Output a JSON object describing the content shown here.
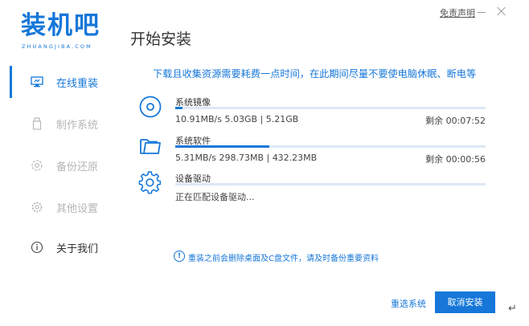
{
  "app": {
    "logo_text": "装机吧",
    "logo_sub": "ZHUANGJIBA.COM",
    "brand_color": "#1677d9",
    "disclaimer": "免责声明"
  },
  "page": {
    "title": "开始安装"
  },
  "sidebar": {
    "items": [
      {
        "label": "在线重装",
        "icon": "monitor-icon",
        "state": "active"
      },
      {
        "label": "制作系统",
        "icon": "usb-drive-icon",
        "state": "disabled"
      },
      {
        "label": "备份还原",
        "icon": "backup-restore-icon",
        "state": "disabled"
      },
      {
        "label": "其他设置",
        "icon": "settings-icon",
        "state": "disabled"
      },
      {
        "label": "关于我们",
        "icon": "info-icon",
        "state": "normal"
      }
    ]
  },
  "main": {
    "status_message": "下载且收集资源需要耗费一点时间，在此期间尽量不要使电脑休眠、断电等",
    "tasks": [
      {
        "name": "系统镜像",
        "icon": "disc-icon",
        "speed": "10.91MB/s 5.03GB | 5.21GB",
        "remaining": "剩余 00:07:52",
        "progress": 0.024
      },
      {
        "name": "系统软件",
        "icon": "folder-icon",
        "speed": "5.31MB/s 298.73MB | 432.23MB",
        "remaining": "剩余 00:00:56",
        "progress": 0.303
      },
      {
        "name": "设备驱动",
        "icon": "gear-icon",
        "speed": "正在匹配设备驱动...",
        "remaining": "",
        "progress": 0
      }
    ],
    "warning": "重装之前会删除桌面及C盘文件，请及时备份重要资料"
  },
  "footer": {
    "reselect_label": "重选系统",
    "cancel_label": "取消安装"
  }
}
